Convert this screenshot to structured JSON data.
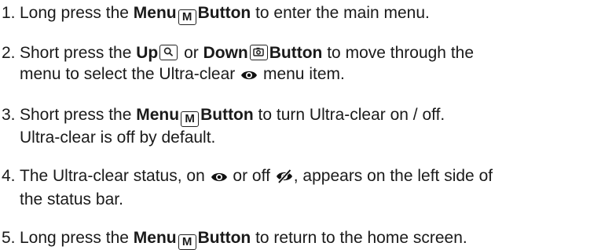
{
  "steps": [
    {
      "num": "1.",
      "lines": [
        {
          "segments": [
            {
              "t": "Long press the "
            },
            {
              "b": "Menu"
            },
            {
              "key": "M"
            },
            {
              "b": "Button"
            },
            {
              "t": " to enter the main menu."
            }
          ]
        }
      ]
    },
    {
      "num": "2.",
      "lines": [
        {
          "segments": [
            {
              "t": "Short press the "
            },
            {
              "b": "Up"
            },
            {
              "keyicon": "search-icon"
            },
            {
              "t": " or "
            },
            {
              "b": "Down"
            },
            {
              "keyicon": "camera-icon"
            },
            {
              "b": "Button"
            },
            {
              "t": " to move through the"
            }
          ]
        },
        {
          "segments": [
            {
              "t": "menu to select the Ultra-clear "
            },
            {
              "icon": "eye-icon"
            },
            {
              "t": " menu item."
            }
          ]
        }
      ]
    },
    {
      "num": "3.",
      "lines": [
        {
          "segments": [
            {
              "t": "Short press the "
            },
            {
              "b": "Menu"
            },
            {
              "key": "M"
            },
            {
              "b": "Button"
            },
            {
              "t": " to turn Ultra-clear on / off."
            }
          ]
        },
        {
          "segments": [
            {
              "t": "Ultra-clear is off by default."
            }
          ]
        }
      ]
    },
    {
      "num": "4.",
      "lines": [
        {
          "segments": [
            {
              "t": "The Ultra-clear status, on "
            },
            {
              "icon": "eye-icon"
            },
            {
              "t": " or off "
            },
            {
              "icon": "eye-off-icon"
            },
            {
              "t": ", appears on the left side of"
            }
          ]
        },
        {
          "segments": [
            {
              "t": "the status bar."
            }
          ]
        }
      ]
    },
    {
      "num": "5.",
      "lines": [
        {
          "segments": [
            {
              "t": "Long press the "
            },
            {
              "b": "Menu"
            },
            {
              "key": "M"
            },
            {
              "b": "Button"
            },
            {
              "t": " to return to the home screen."
            }
          ]
        }
      ]
    }
  ]
}
